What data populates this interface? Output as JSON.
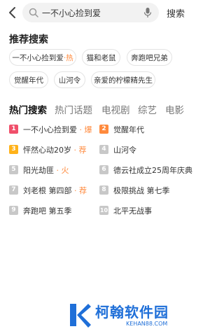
{
  "colors": {
    "accent": "#ff8a3d",
    "badge_red": "#f04f6a",
    "badge_orange": "#ff8a3d",
    "badge_yellow": "#ffb21a",
    "badge_gray": "#c8c8c8",
    "watermark_blue": "#1f6fd8"
  },
  "header": {
    "search_query": "一不小心捡到爱",
    "search_button": "搜索",
    "back_icon": "chevron-left-icon",
    "search_icon": "search-icon",
    "mic_icon": "microphone-icon"
  },
  "recommended": {
    "title": "推荐搜索",
    "chips": [
      {
        "label": "一不小心捡到爱",
        "tag": "·热"
      },
      {
        "label": "猫和老鼠",
        "tag": ""
      },
      {
        "label": "奔跑吧兄弟",
        "tag": ""
      },
      {
        "label": "觉醒年代",
        "tag": ""
      },
      {
        "label": "山河令",
        "tag": ""
      },
      {
        "label": "亲爱的柠檬精先生",
        "tag": ""
      }
    ]
  },
  "tabs": [
    {
      "label": "热门搜索"
    },
    {
      "label": "热门话题"
    },
    {
      "label": "电视剧"
    },
    {
      "label": "综艺"
    },
    {
      "label": "电影"
    }
  ],
  "hot_list": [
    {
      "rank": "1",
      "title": "一不小心捡到爱",
      "tag": " · 爆"
    },
    {
      "rank": "2",
      "title": "觉醒年代",
      "tag": ""
    },
    {
      "rank": "3",
      "title": "怦然心动20岁",
      "tag": " · 荐"
    },
    {
      "rank": "4",
      "title": "山河令",
      "tag": ""
    },
    {
      "rank": "5",
      "title": "阳光劫匪",
      "tag": " · 火"
    },
    {
      "rank": "6",
      "title": "德云社成立25周年庆典",
      "tag": ""
    },
    {
      "rank": "7",
      "title": "刘老根 第四部",
      "tag": " · 荐"
    },
    {
      "rank": "8",
      "title": "极限挑战 第七季",
      "tag": ""
    },
    {
      "rank": "9",
      "title": "奔跑吧 第五季",
      "tag": ""
    },
    {
      "rank": "10",
      "title": "北平无战事",
      "tag": ""
    }
  ],
  "watermark": {
    "logo_text": "柯翰软件园",
    "url": "KEHAN88.COM"
  }
}
